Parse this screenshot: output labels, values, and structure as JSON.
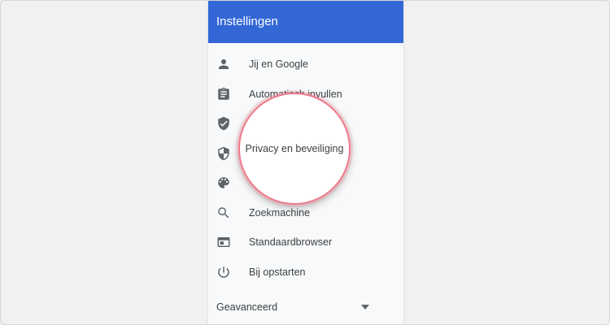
{
  "header": {
    "title": "Instellingen"
  },
  "menu": {
    "items": [
      {
        "label": "Jij en Google",
        "icon": "person-icon"
      },
      {
        "label": "Automatisch invullen",
        "icon": "clipboard-icon"
      },
      {
        "label": "",
        "icon": "shield-check-icon"
      },
      {
        "label": "",
        "icon": "shield-half-icon"
      },
      {
        "label": "",
        "icon": "palette-icon"
      },
      {
        "label": "Zoekmachine",
        "icon": "search-icon"
      },
      {
        "label": "Standaardbrowser",
        "icon": "browser-window-icon"
      },
      {
        "label": "Bij opstarten",
        "icon": "power-icon"
      }
    ]
  },
  "advanced": {
    "label": "Geavanceerd",
    "icon": "caret-down-icon"
  },
  "magnifier": {
    "label": "Privacy en beveiliging"
  },
  "colors": {
    "header_bg": "#3367d6",
    "highlight_ring": "#f07a8a",
    "icon": "#5f6368",
    "text": "#3c4043"
  }
}
